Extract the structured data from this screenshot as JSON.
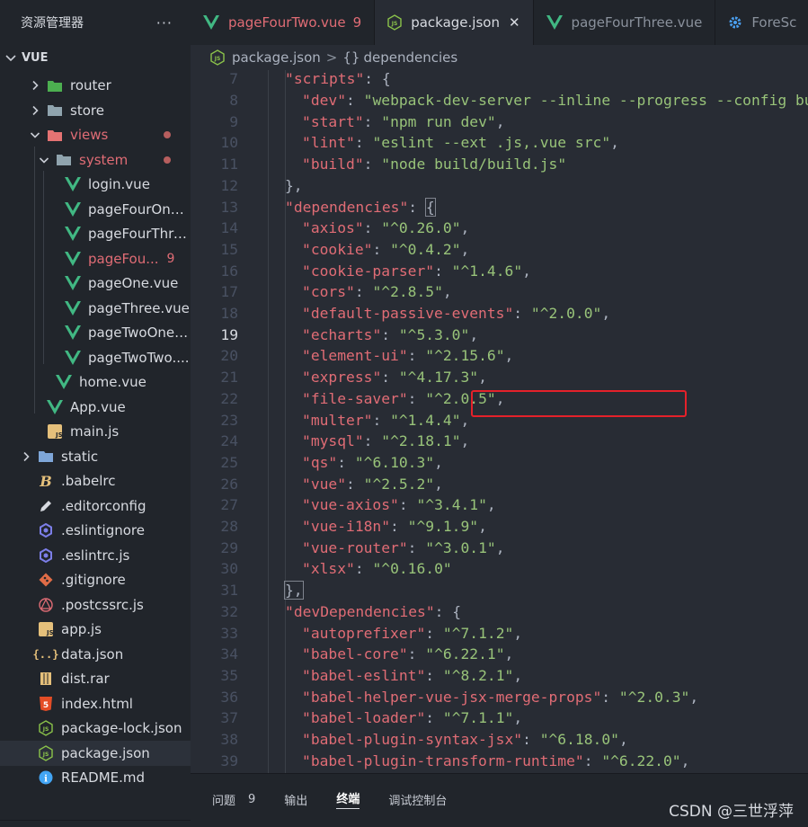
{
  "explorer": {
    "title": "资源管理器",
    "more": "···",
    "section": "VUE"
  },
  "tree": [
    {
      "label": "router",
      "indent": 2,
      "chevron": "right",
      "icon": "router-folder-icon",
      "glyph": "▬",
      "color": "#4caf50"
    },
    {
      "label": "store",
      "indent": 2,
      "chevron": "right",
      "icon": "folder-icon",
      "glyph": "▬",
      "color": "#90a4ae"
    },
    {
      "label": "views",
      "indent": 2,
      "chevron": "down",
      "icon": "views-folder-icon",
      "glyph": "▬",
      "color": "#e57373",
      "modified": true,
      "dot": true
    },
    {
      "label": "system",
      "indent": 3,
      "chevron": "down",
      "icon": "folder-open-icon",
      "glyph": "▬",
      "color": "#90a4ae",
      "modified": true,
      "dot": true
    },
    {
      "label": "login.vue",
      "indent": 4,
      "icon": "vue-icon",
      "glyph": "V",
      "color": "#41b883"
    },
    {
      "label": "pageFourOne...",
      "indent": 4,
      "icon": "vue-icon",
      "glyph": "V",
      "color": "#41b883"
    },
    {
      "label": "pageFourThre...",
      "indent": 4,
      "icon": "vue-icon",
      "glyph": "V",
      "color": "#41b883"
    },
    {
      "label": "pageFou...",
      "indent": 4,
      "icon": "vue-icon",
      "glyph": "V",
      "color": "#41b883",
      "modified": true,
      "badge": "9"
    },
    {
      "label": "pageOne.vue",
      "indent": 4,
      "icon": "vue-icon",
      "glyph": "V",
      "color": "#41b883"
    },
    {
      "label": "pageThree.vue",
      "indent": 4,
      "icon": "vue-icon",
      "glyph": "V",
      "color": "#41b883"
    },
    {
      "label": "pageTwoOne....",
      "indent": 4,
      "icon": "vue-icon",
      "glyph": "V",
      "color": "#41b883"
    },
    {
      "label": "pageTwoTwo....",
      "indent": 4,
      "icon": "vue-icon",
      "glyph": "V",
      "color": "#41b883"
    },
    {
      "label": "home.vue",
      "indent": 3,
      "icon": "vue-icon",
      "glyph": "V",
      "color": "#41b883"
    },
    {
      "label": "App.vue",
      "indent": 2,
      "icon": "vue-icon",
      "glyph": "V",
      "color": "#41b883"
    },
    {
      "label": "main.js",
      "indent": 2,
      "icon": "js-icon",
      "glyph": "JS",
      "color": "#e5c07b"
    },
    {
      "label": "static",
      "indent": 1,
      "chevron": "right",
      "icon": "folder-icon",
      "glyph": "▬",
      "color": "#7ea6d8"
    },
    {
      "label": ".babelrc",
      "indent": 1,
      "icon": "babel-icon",
      "glyph": "B",
      "color": "#e5c07b"
    },
    {
      "label": ".editorconfig",
      "indent": 1,
      "icon": "editorconfig-icon",
      "glyph": "✎",
      "color": "#d7dae0"
    },
    {
      "label": ".eslintignore",
      "indent": 1,
      "icon": "eslint-icon",
      "glyph": "◉",
      "color": "#7c7ee8"
    },
    {
      "label": ".eslintrc.js",
      "indent": 1,
      "icon": "eslint-icon",
      "glyph": "◉",
      "color": "#7c7ee8"
    },
    {
      "label": ".gitignore",
      "indent": 1,
      "icon": "git-icon",
      "glyph": "◆",
      "color": "#e06c47"
    },
    {
      "label": ".postcssrc.js",
      "indent": 1,
      "icon": "postcss-icon",
      "glyph": "◎",
      "color": "#e06c75"
    },
    {
      "label": "app.js",
      "indent": 1,
      "icon": "js-icon",
      "glyph": "JS",
      "color": "#e5c07b"
    },
    {
      "label": "data.json",
      "indent": 1,
      "icon": "json-braces-icon",
      "glyph": "{}",
      "color": "#e5c07b"
    },
    {
      "label": "dist.rar",
      "indent": 1,
      "icon": "archive-icon",
      "glyph": "▤",
      "color": "#e5c07b"
    },
    {
      "label": "index.html",
      "indent": 1,
      "icon": "html-icon",
      "glyph": "5",
      "color": "#e44d26"
    },
    {
      "label": "package-lock.json",
      "indent": 1,
      "icon": "nodejs-icon",
      "glyph": "JS",
      "color": "#8bc34a"
    },
    {
      "label": "package.json",
      "indent": 1,
      "icon": "nodejs-icon",
      "glyph": "JS",
      "color": "#8bc34a",
      "selected": true
    },
    {
      "label": "README.md",
      "indent": 1,
      "icon": "info-icon",
      "glyph": "i",
      "color": "#42a5f5"
    }
  ],
  "tabs": [
    {
      "label": "pageFourTwo.vue",
      "icon": "vue-icon",
      "badge": "9",
      "modified": true
    },
    {
      "label": "package.json",
      "icon": "nodejs-icon",
      "active": true,
      "close": "✕"
    },
    {
      "label": "pageFourThree.vue",
      "icon": "vue-icon"
    },
    {
      "label": "ForeSc",
      "icon": "gear-icon"
    }
  ],
  "breadcrumb": {
    "file": "package.json",
    "separator": ">",
    "symbol_icon": "{}",
    "symbol": "dependencies"
  },
  "code": {
    "current_line": 19,
    "lines": [
      {
        "n": 7,
        "indent": 1,
        "key": "scripts",
        "val": null,
        "open": "{"
      },
      {
        "n": 8,
        "indent": 2,
        "key": "dev",
        "val": "webpack-dev-server --inline --progress --config build/webpack.dev.conf.js",
        "comma": true
      },
      {
        "n": 9,
        "indent": 2,
        "key": "start",
        "val": "npm run dev",
        "comma": true
      },
      {
        "n": 10,
        "indent": 2,
        "key": "lint",
        "val": "eslint --ext .js,.vue src",
        "comma": true
      },
      {
        "n": 11,
        "indent": 2,
        "key": "build",
        "val": "node build/build.js"
      },
      {
        "n": 12,
        "indent": 1,
        "raw": "},"
      },
      {
        "n": 13,
        "indent": 1,
        "key": "dependencies",
        "val": null,
        "open": "{",
        "open_hl": true
      },
      {
        "n": 14,
        "indent": 2,
        "key": "axios",
        "val": "^0.26.0",
        "comma": true
      },
      {
        "n": 15,
        "indent": 2,
        "key": "cookie",
        "val": "^0.4.2",
        "comma": true
      },
      {
        "n": 16,
        "indent": 2,
        "key": "cookie-parser",
        "val": "^1.4.6",
        "comma": true
      },
      {
        "n": 17,
        "indent": 2,
        "key": "cors",
        "val": "^2.8.5",
        "comma": true
      },
      {
        "n": 18,
        "indent": 2,
        "key": "default-passive-events",
        "val": "^2.0.0",
        "comma": true
      },
      {
        "n": 19,
        "indent": 2,
        "key": "echarts",
        "val": "^5.3.0",
        "comma": true
      },
      {
        "n": 20,
        "indent": 2,
        "key": "element-ui",
        "val": "^2.15.6",
        "comma": true
      },
      {
        "n": 21,
        "indent": 2,
        "key": "express",
        "val": "^4.17.3",
        "comma": true
      },
      {
        "n": 22,
        "indent": 2,
        "key": "file-saver",
        "val": "^2.0.5",
        "comma": true
      },
      {
        "n": 23,
        "indent": 2,
        "key": "multer",
        "val": "^1.4.4",
        "comma": true
      },
      {
        "n": 24,
        "indent": 2,
        "key": "mysql",
        "val": "^2.18.1",
        "comma": true
      },
      {
        "n": 25,
        "indent": 2,
        "key": "qs",
        "val": "^6.10.3",
        "comma": true
      },
      {
        "n": 26,
        "indent": 2,
        "key": "vue",
        "val": "^2.5.2",
        "comma": true
      },
      {
        "n": 27,
        "indent": 2,
        "key": "vue-axios",
        "val": "^3.4.1",
        "comma": true
      },
      {
        "n": 28,
        "indent": 2,
        "key": "vue-i18n",
        "val": "^9.1.9",
        "comma": true
      },
      {
        "n": 29,
        "indent": 2,
        "key": "vue-router",
        "val": "^3.0.1",
        "comma": true
      },
      {
        "n": 30,
        "indent": 2,
        "key": "xlsx",
        "val": "^0.16.0"
      },
      {
        "n": 31,
        "indent": 1,
        "raw": "},",
        "close_hl": true
      },
      {
        "n": 32,
        "indent": 1,
        "key": "devDependencies",
        "val": null,
        "open": "{"
      },
      {
        "n": 33,
        "indent": 2,
        "key": "autoprefixer",
        "val": "^7.1.2",
        "comma": true
      },
      {
        "n": 34,
        "indent": 2,
        "key": "babel-core",
        "val": "^6.22.1",
        "comma": true
      },
      {
        "n": 35,
        "indent": 2,
        "key": "babel-eslint",
        "val": "^8.2.1",
        "comma": true
      },
      {
        "n": 36,
        "indent": 2,
        "key": "babel-helper-vue-jsx-merge-props",
        "val": "^2.0.3",
        "comma": true
      },
      {
        "n": 37,
        "indent": 2,
        "key": "babel-loader",
        "val": "^7.1.1",
        "comma": true
      },
      {
        "n": 38,
        "indent": 2,
        "key": "babel-plugin-syntax-jsx",
        "val": "^6.18.0",
        "comma": true
      },
      {
        "n": 39,
        "indent": 2,
        "key": "babel-plugin-transform-runtime",
        "val": "^6.22.0",
        "comma": true
      }
    ]
  },
  "panel": {
    "tabs": [
      {
        "label": "问题",
        "badge": "9"
      },
      {
        "label": "输出"
      },
      {
        "label": "终端",
        "active": true
      },
      {
        "label": "调试控制台"
      }
    ],
    "watermark": "CSDN @三世浮萍"
  },
  "colors": {
    "annotation_box": "#e5212a",
    "modified": "#e06c75",
    "string": "#98c379",
    "key": "#e06c75"
  }
}
